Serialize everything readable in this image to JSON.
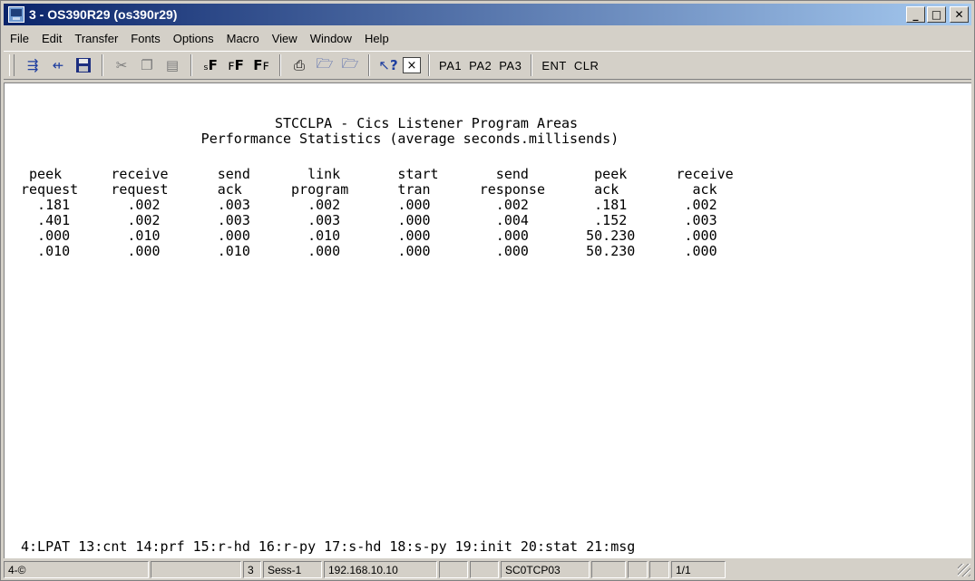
{
  "window": {
    "title": "3 - OS390R29 (os390r29)"
  },
  "menu": [
    "File",
    "Edit",
    "Transfer",
    "Fonts",
    "Options",
    "Macro",
    "View",
    "Window",
    "Help"
  ],
  "toolbar": {
    "icons": [
      "send-icon",
      "receive-icon",
      "save-icon",
      "cut-icon",
      "copy-icon",
      "paste-icon",
      "font-large-icon",
      "font-medium-icon",
      "font-small-icon",
      "print-icon",
      "open-folder-icon",
      "open-folder-2-icon",
      "help-pointer-icon",
      "close-box-icon"
    ],
    "help_glyph": "?",
    "close_glyph": "×",
    "font_glyph": "F",
    "keys": [
      "PA1",
      "PA2",
      "PA3",
      "ENT",
      "CLR"
    ]
  },
  "terminal": {
    "lines": [
      "                               STCCLPA - Cics Listener Program Areas",
      "                      Performance Statistics (average seconds.millisends)",
      "",
      " peek      receive      send       link       start       send        peek      receive",
      "request    request      ack      program      tran      response      ack         ack",
      "  .181       .002       .003       .002       .000        .002        .181       .002",
      "  .401       .002       .003       .003       .000        .004        .152       .003",
      "  .000       .010       .000       .010       .000        .000       50.230      .000",
      "  .010       .000       .010       .000       .000        .000       50.230      .000"
    ],
    "pf_keys": "4:LPAT 13:cnt 14:prf 15:r-hd 16:r-py 17:s-hd 18:s-py 19:init 20:stat 21:msg"
  },
  "statusbar": {
    "cells": [
      "4-©",
      "",
      "3",
      "Sess-1",
      "192.168.10.10",
      "",
      "",
      "SC0TCP03",
      "",
      "",
      "",
      "1/1"
    ]
  },
  "colors": {
    "titlebar_start": "#0a246a",
    "titlebar_end": "#a6caf0",
    "chrome": "#d4d0c8",
    "screen": "#ffffff"
  }
}
